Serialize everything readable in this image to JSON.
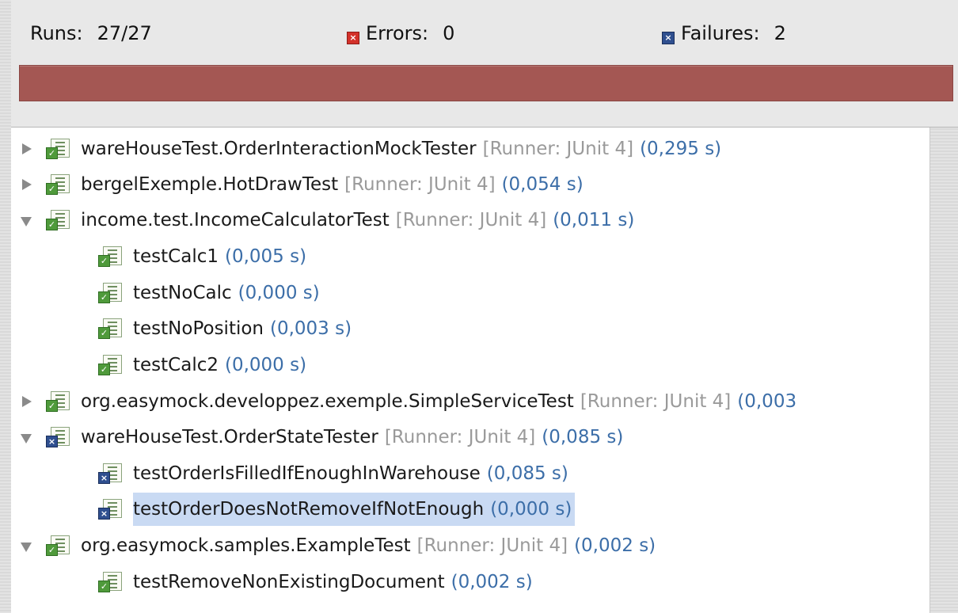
{
  "summary": {
    "runs_label": "Runs:",
    "runs_value": "27/27",
    "errors_label": "Errors:",
    "errors_value": "0",
    "failures_label": "Failures:",
    "failures_value": "2",
    "errors_icon": "error-icon",
    "failures_icon": "failure-icon"
  },
  "progress": {
    "percent": 100,
    "status": "failed",
    "color": "#a45753"
  },
  "colors": {
    "time": "#3c6ea8",
    "runner": "#9a9a9a",
    "selection": "#c9daf3",
    "pass_badge": "#4f9a3b",
    "fail_badge": "#2f4f8f"
  },
  "tree": {
    "rows": [
      {
        "name": "wareHouseTest.OrderInteractionMockTester",
        "runner": "[Runner: JUnit 4]",
        "time": "(0,295 s)",
        "status": "pass",
        "kind": "suite",
        "expanded": false
      },
      {
        "name": "bergelExemple.HotDrawTest",
        "runner": "[Runner: JUnit 4]",
        "time": "(0,054 s)",
        "status": "pass",
        "kind": "suite",
        "expanded": false
      },
      {
        "name": "income.test.IncomeCalculatorTest",
        "runner": "[Runner: JUnit 4]",
        "time": "(0,011 s)",
        "status": "pass",
        "kind": "suite",
        "expanded": true
      },
      {
        "name": "testCalc1",
        "time": "(0,005 s)",
        "status": "pass",
        "kind": "test"
      },
      {
        "name": "testNoCalc",
        "time": "(0,000 s)",
        "status": "pass",
        "kind": "test"
      },
      {
        "name": "testNoPosition",
        "time": "(0,003 s)",
        "status": "pass",
        "kind": "test"
      },
      {
        "name": "testCalc2",
        "time": "(0,000 s)",
        "status": "pass",
        "kind": "test"
      },
      {
        "name": "org.easymock.developpez.exemple.SimpleServiceTest",
        "runner": "[Runner: JUnit 4]",
        "time": "(0,003",
        "status": "pass",
        "kind": "suite",
        "expanded": false
      },
      {
        "name": "wareHouseTest.OrderStateTester",
        "runner": "[Runner: JUnit 4]",
        "time": "(0,085 s)",
        "status": "fail",
        "kind": "suite",
        "expanded": true
      },
      {
        "name": "testOrderIsFilledIfEnoughInWarehouse",
        "time": "(0,085 s)",
        "status": "fail",
        "kind": "test"
      },
      {
        "name": "testOrderDoesNotRemoveIfNotEnough",
        "time": "(0,000 s)",
        "status": "fail",
        "kind": "test",
        "selected": true
      },
      {
        "name": "org.easymock.samples.ExampleTest",
        "runner": "[Runner: JUnit 4]",
        "time": "(0,002 s)",
        "status": "pass",
        "kind": "suite",
        "expanded": true
      },
      {
        "name": "testRemoveNonExistingDocument",
        "time": "(0,002 s)",
        "status": "pass",
        "kind": "test"
      }
    ]
  }
}
